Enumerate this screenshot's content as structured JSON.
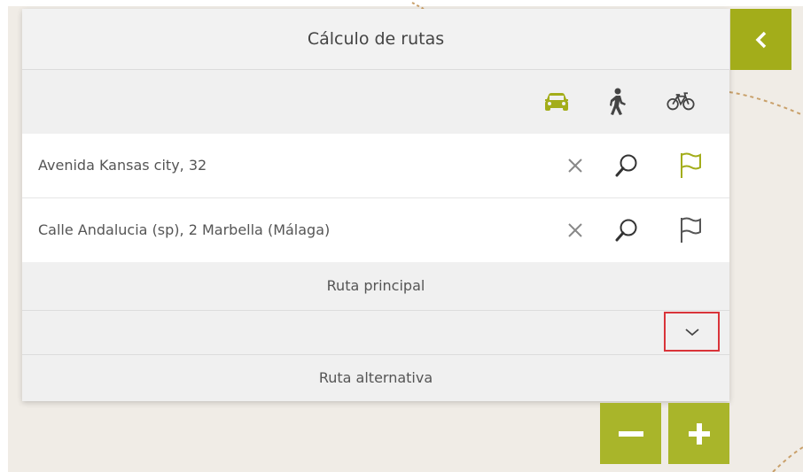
{
  "panel": {
    "title": "Cálculo de rutas",
    "modes": [
      {
        "name": "car",
        "icon": "car-icon",
        "active": true
      },
      {
        "name": "walk",
        "icon": "walking-person-icon",
        "active": false
      },
      {
        "name": "bike",
        "icon": "bicycle-icon",
        "active": false
      }
    ],
    "origin": {
      "value": "Avenida Kansas city, 32",
      "flag_color": "#a3ad1a"
    },
    "destination": {
      "value": "Calle Andalucia (sp), 2 Marbella (Málaga)",
      "flag_color": "#555555"
    },
    "main_route_label": "Ruta principal",
    "alternative_route_label": "Ruta alternativa"
  },
  "controls": {
    "collapse_icon": "chevron-left-icon",
    "zoom_out_icon": "minus-icon",
    "zoom_in_icon": "plus-icon"
  },
  "colors": {
    "accent": "#a3ad1a",
    "highlight_border": "#d9343a",
    "panel_bg": "#f0f0f0",
    "map_bg": "#f0ece6"
  }
}
